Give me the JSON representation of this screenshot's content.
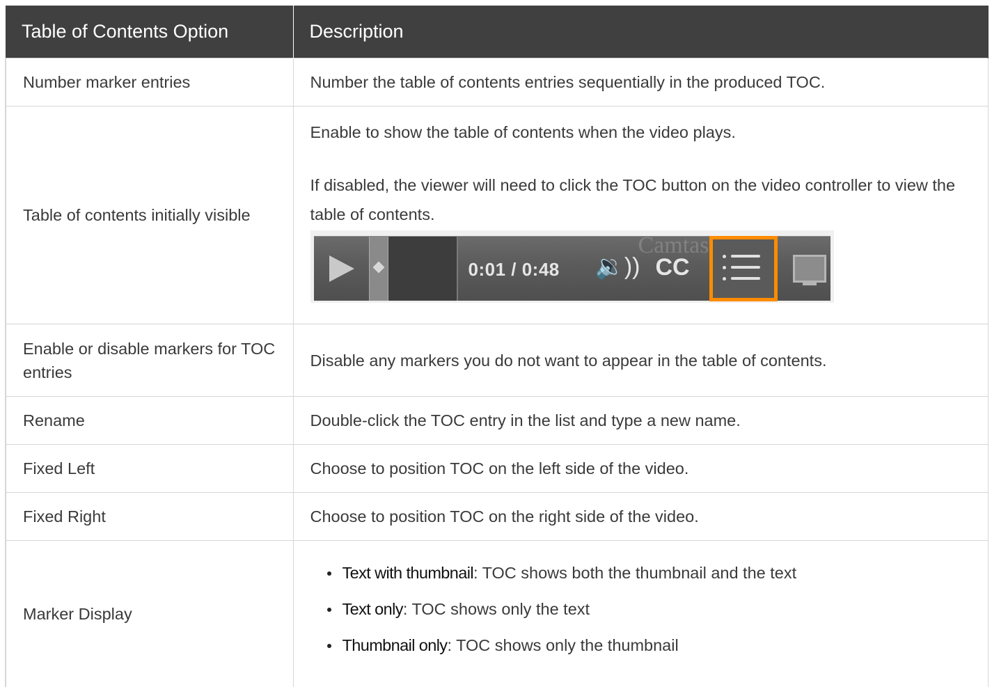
{
  "header": {
    "col1": "Table of Contents Option",
    "col2": "Description"
  },
  "rows": [
    {
      "option": "Number marker entries",
      "description": "Number the table of contents entries sequentially in the produced TOC."
    },
    {
      "option": "Table of contents initially visible",
      "description_p1": "Enable to show the table of contents when the video plays.",
      "description_p2": "If disabled, the viewer will need to click the TOC button on the video controller to view the table of contents."
    },
    {
      "option": "Enable or disable markers for TOC entries",
      "description": "Disable any markers you do not want to appear in the table of contents."
    },
    {
      "option": "Rename",
      "description": "Double-click the TOC entry in the list and type a new name."
    },
    {
      "option": "Fixed Left",
      "description": "Choose to position TOC on the left side of the video."
    },
    {
      "option": "Fixed Right",
      "description": "Choose to position TOC on the right side of the video."
    },
    {
      "option": "Marker Display",
      "bullets": [
        {
          "term": "Text with thumbnail",
          "text": ": TOC shows both the thumbnail and the text"
        },
        {
          "term": "Text only",
          "text": ": TOC shows only the text"
        },
        {
          "term": "Thumbnail only",
          "text": ": TOC shows only the thumbnail"
        }
      ]
    }
  ],
  "player": {
    "time": "0:01  /  0:48",
    "cc_label": "CC",
    "volume_glyph": "🔉))",
    "ghost_text": "Camtasia",
    "toc_highlight_color": "#ff8c00",
    "icons": [
      "play-icon",
      "volume-icon",
      "cc-icon",
      "toc-icon",
      "fullscreen-icon"
    ]
  }
}
